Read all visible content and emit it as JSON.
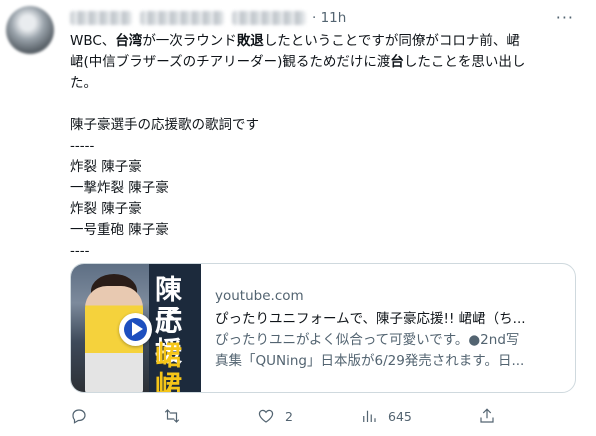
{
  "tweet": {
    "timestamp": "· 11h",
    "more_label": "···",
    "body_lines": [
      [
        {
          "t": "WBC、"
        },
        {
          "t": "台湾",
          "b": true
        },
        {
          "t": "が一次ラウンド"
        },
        {
          "t": "敗退",
          "b": true
        },
        {
          "t": "したということですが同僚がコロナ前、峮"
        }
      ],
      [
        {
          "t": "峮(中信ブラザーズのチアリーダー)観るためだけに渡"
        },
        {
          "t": "台",
          "b": true
        },
        {
          "t": "したことを思い出し"
        }
      ],
      [
        {
          "t": "た。"
        }
      ],
      [
        {
          "t": ""
        }
      ],
      [
        {
          "t": "陳子豪選手の応援歌の歌詞です"
        }
      ],
      [
        {
          "t": "-----"
        }
      ],
      [
        {
          "t": "炸裂 陳子豪"
        }
      ],
      [
        {
          "t": "一撃炸裂 陳子豪"
        }
      ],
      [
        {
          "t": "炸裂 陳子豪"
        }
      ],
      [
        {
          "t": "一号重砲 陳子豪"
        }
      ],
      [
        {
          "t": "----"
        }
      ]
    ]
  },
  "card": {
    "domain": "youtube.com",
    "title": "ぴったりユニフォームで、陳子豪応援!! 峮峮（ち...",
    "description_line1": "ぴったりユニがよく似合って可愛いです。●2nd写",
    "description_line2": "真集「QUNing」日本版が6/29発売されます。日...",
    "thumb_text": [
      "陳子",
      "応援",
      "峮峮"
    ]
  },
  "actions": {
    "reply_count": "",
    "retweet_count": "",
    "like_count": "2",
    "views_count": "645"
  },
  "colors": {
    "text": "#0f1419",
    "secondary": "#536471",
    "border": "#cfd9de",
    "play_blue": "#1d4fbf"
  }
}
